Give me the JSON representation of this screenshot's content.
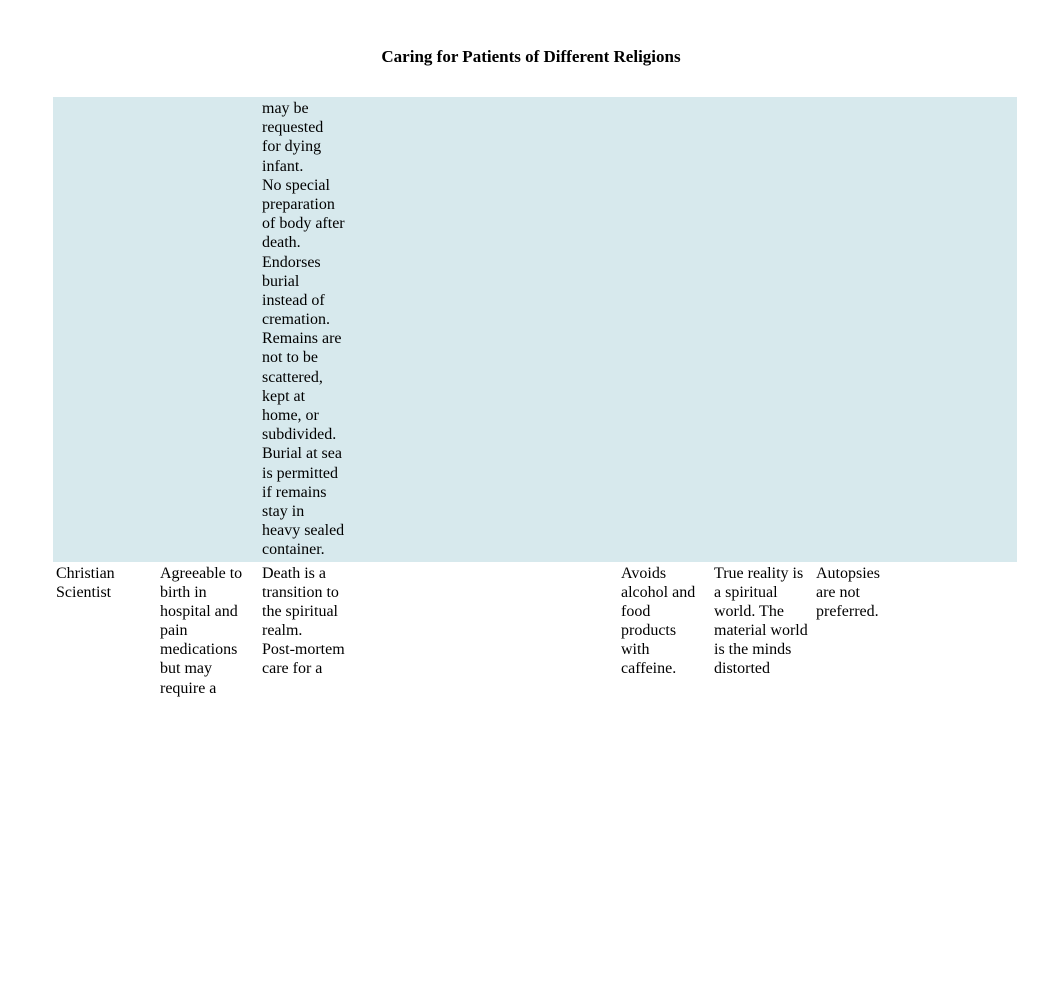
{
  "title": "Caring for Patients of Different Religions",
  "rows": [
    {
      "shaded": true,
      "cells": [
        "",
        "",
        "may be requested for dying infant.\nNo special preparation of body after death.\nEndorses burial instead of cremation.  Remains are not to be scattered, kept at home, or subdivided.\nBurial at sea is permitted if remains stay in heavy sealed container.",
        "",
        "",
        "",
        "",
        "",
        "",
        ""
      ]
    },
    {
      "shaded": false,
      "cells": [
        "Christian Scientist",
        "Agreeable to birth in hospital and pain medications but may require a",
        "Death is a transition to the spiritual realm.\nPost-mortem care for a",
        "",
        "",
        "",
        "Avoids alcohol and food products with caffeine.",
        "True reality is a spiritual world.  The material world is the minds distorted",
        "Autopsies are not preferred.",
        ""
      ]
    }
  ]
}
